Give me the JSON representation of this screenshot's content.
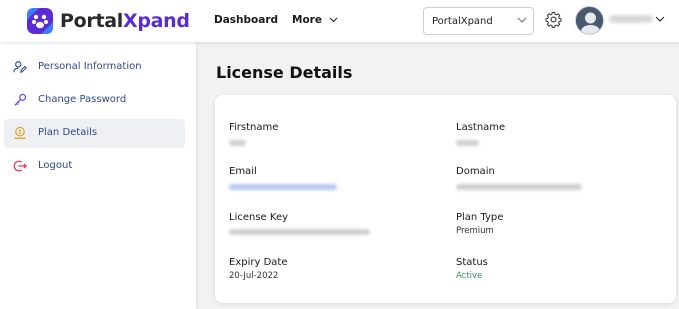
{
  "brand": {
    "part1": "Portal",
    "part2": "Xpand"
  },
  "nav": {
    "dashboard": "Dashboard",
    "more": "More"
  },
  "workspace_select": {
    "value": "PortalXpand"
  },
  "sidebar": {
    "items": [
      {
        "label": "Personal Information",
        "icon": "user-edit-icon",
        "active": false
      },
      {
        "label": "Change Password",
        "icon": "key-icon",
        "active": false
      },
      {
        "label": "Plan Details",
        "icon": "coin-icon",
        "active": true
      },
      {
        "label": "Logout",
        "icon": "logout-icon",
        "active": false
      }
    ]
  },
  "page": {
    "title": "License Details"
  },
  "details": {
    "firstname_label": "Firstname",
    "lastname_label": "Lastname",
    "email_label": "Email",
    "domain_label": "Domain",
    "license_key_label": "License Key",
    "plan_type_label": "Plan Type",
    "plan_type_value": "Premium",
    "expiry_label": "Expiry Date",
    "expiry_value": "20-Jul-2022",
    "status_label": "Status",
    "status_value": "Active"
  },
  "colors": {
    "brand_purple": "#5b2bd6",
    "active_status": "#2e9e55",
    "link_blue": "#2d4a8a"
  }
}
